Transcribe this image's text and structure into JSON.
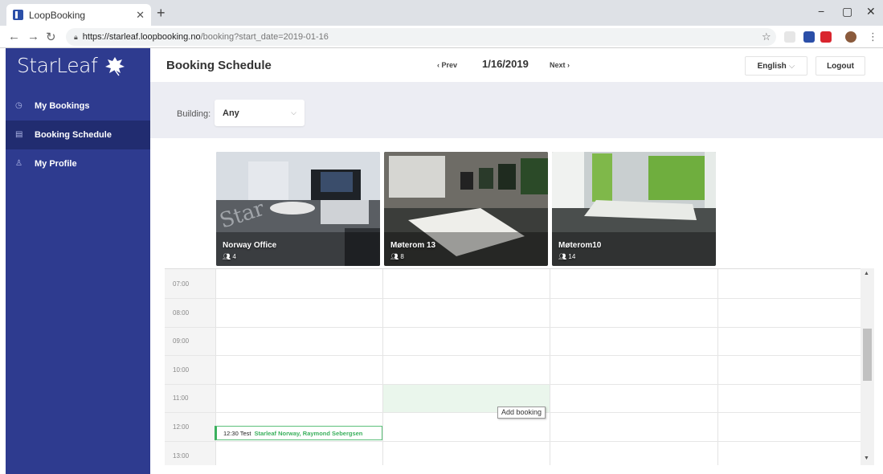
{
  "browser": {
    "tab_title": "LoopBooking",
    "tab_close": "✕",
    "new_tab": "+",
    "url_host": "https://starleaf.loopbooking.no",
    "url_path": "/booking?start_date=2019-01-16",
    "window_controls": [
      "−",
      "▢",
      "✕"
    ]
  },
  "sidebar": {
    "logo": "StarLeaf",
    "items": [
      {
        "label": "My Bookings",
        "icon": "clock-icon",
        "glyph": "◷",
        "active": false
      },
      {
        "label": "Booking Schedule",
        "icon": "calendar-icon",
        "glyph": "▤",
        "active": true
      },
      {
        "label": "My Profile",
        "icon": "user-icon",
        "glyph": "♙",
        "active": false
      }
    ]
  },
  "header": {
    "title": "Booking Schedule",
    "prev_label": "‹ Prev",
    "date": "1/16/2019",
    "next_label": "Next ›",
    "language": "English",
    "logout": "Logout"
  },
  "filter": {
    "label": "Building:",
    "value": "Any"
  },
  "rooms": [
    {
      "name": "Norway Office",
      "capacity": "4"
    },
    {
      "name": "Møterom 13",
      "capacity": "8"
    },
    {
      "name": "Møterom10",
      "capacity": "14"
    }
  ],
  "times": [
    "07:00",
    "08:00",
    "09:00",
    "10:00",
    "11:00",
    "12:00",
    "13:00"
  ],
  "tooltip": "Add booking",
  "booking": {
    "time_title": "12:30 Test",
    "owner": "Starleaf Norway, Raymond Sebergsen"
  },
  "colors": {
    "sidebar": "#2e3b8f",
    "sidebar_active": "#212c70",
    "booking_green": "#3bb05d"
  }
}
